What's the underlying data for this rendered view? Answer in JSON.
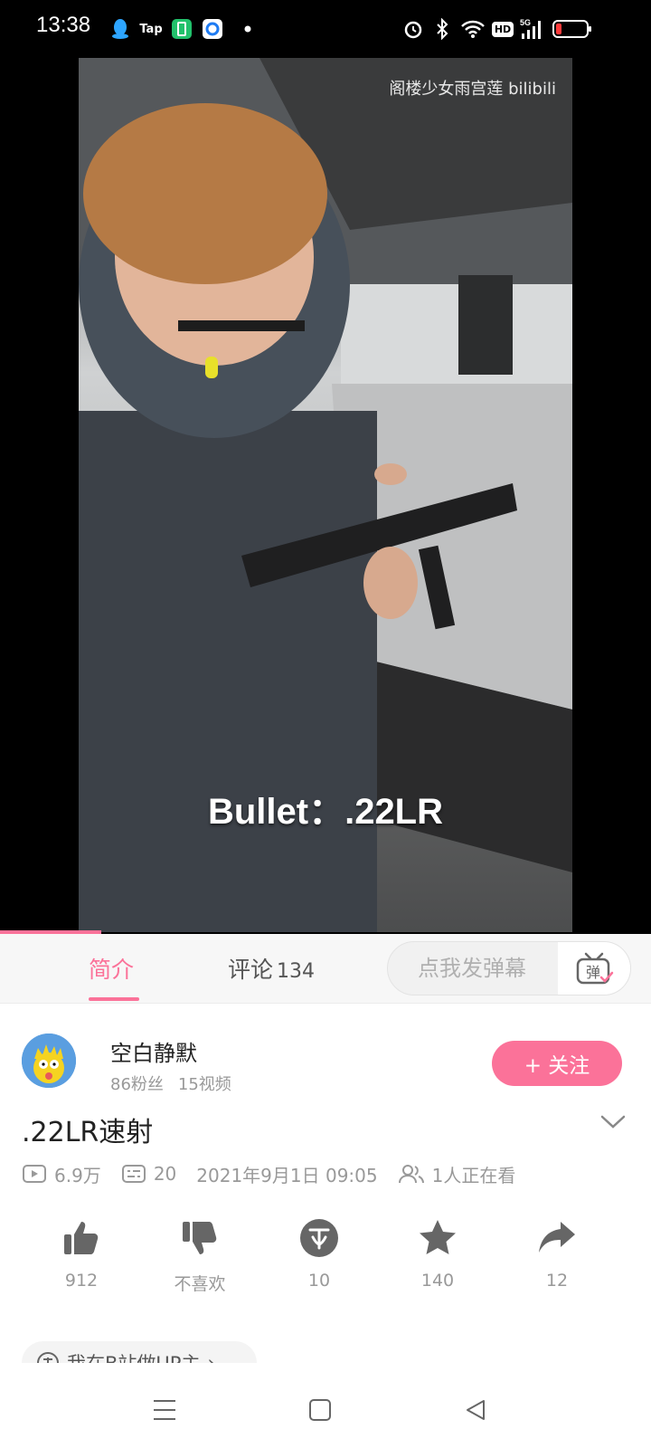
{
  "status_bar": {
    "time": "13:38",
    "app_badge_tap": "Tap",
    "network_label": "5G",
    "hd_label": "HD",
    "icons": [
      "qq-icon",
      "taptap-icon",
      "green-app-icon",
      "browser-icon",
      "dot-icon",
      "alarm-icon",
      "bluetooth-icon",
      "wifi-icon",
      "hd-icon",
      "signal-5g-icon",
      "battery-low-icon"
    ]
  },
  "video": {
    "caption": "Bullet：.22LR",
    "watermark": "阁楼少女雨宫莲  bilibili",
    "progress_fraction": 0.155
  },
  "tabs": {
    "intro": "简介",
    "comments": "评论",
    "comments_count": "134",
    "danmaku_placeholder": "点我发弹幕",
    "danmaku_toggle_label": "弹"
  },
  "uploader": {
    "name": "空白静默",
    "followers": "86粉丝",
    "videos": "15视频",
    "follow_label": "+ 关注"
  },
  "video_info": {
    "title": ".22LR速射",
    "views": "6.9万",
    "danmaku_count": "20",
    "publish_time": "2021年9月1日 09:05",
    "watching": "1人正在看"
  },
  "actions": {
    "like": "912",
    "dislike": "不喜欢",
    "coin": "10",
    "favorite": "140",
    "share": "12"
  },
  "up_chip": {
    "label": "我在B站做UP主",
    "chevron": "›"
  },
  "colors": {
    "accent": "#fb7299",
    "icon_gray": "#666666",
    "meta_gray": "#999999"
  }
}
